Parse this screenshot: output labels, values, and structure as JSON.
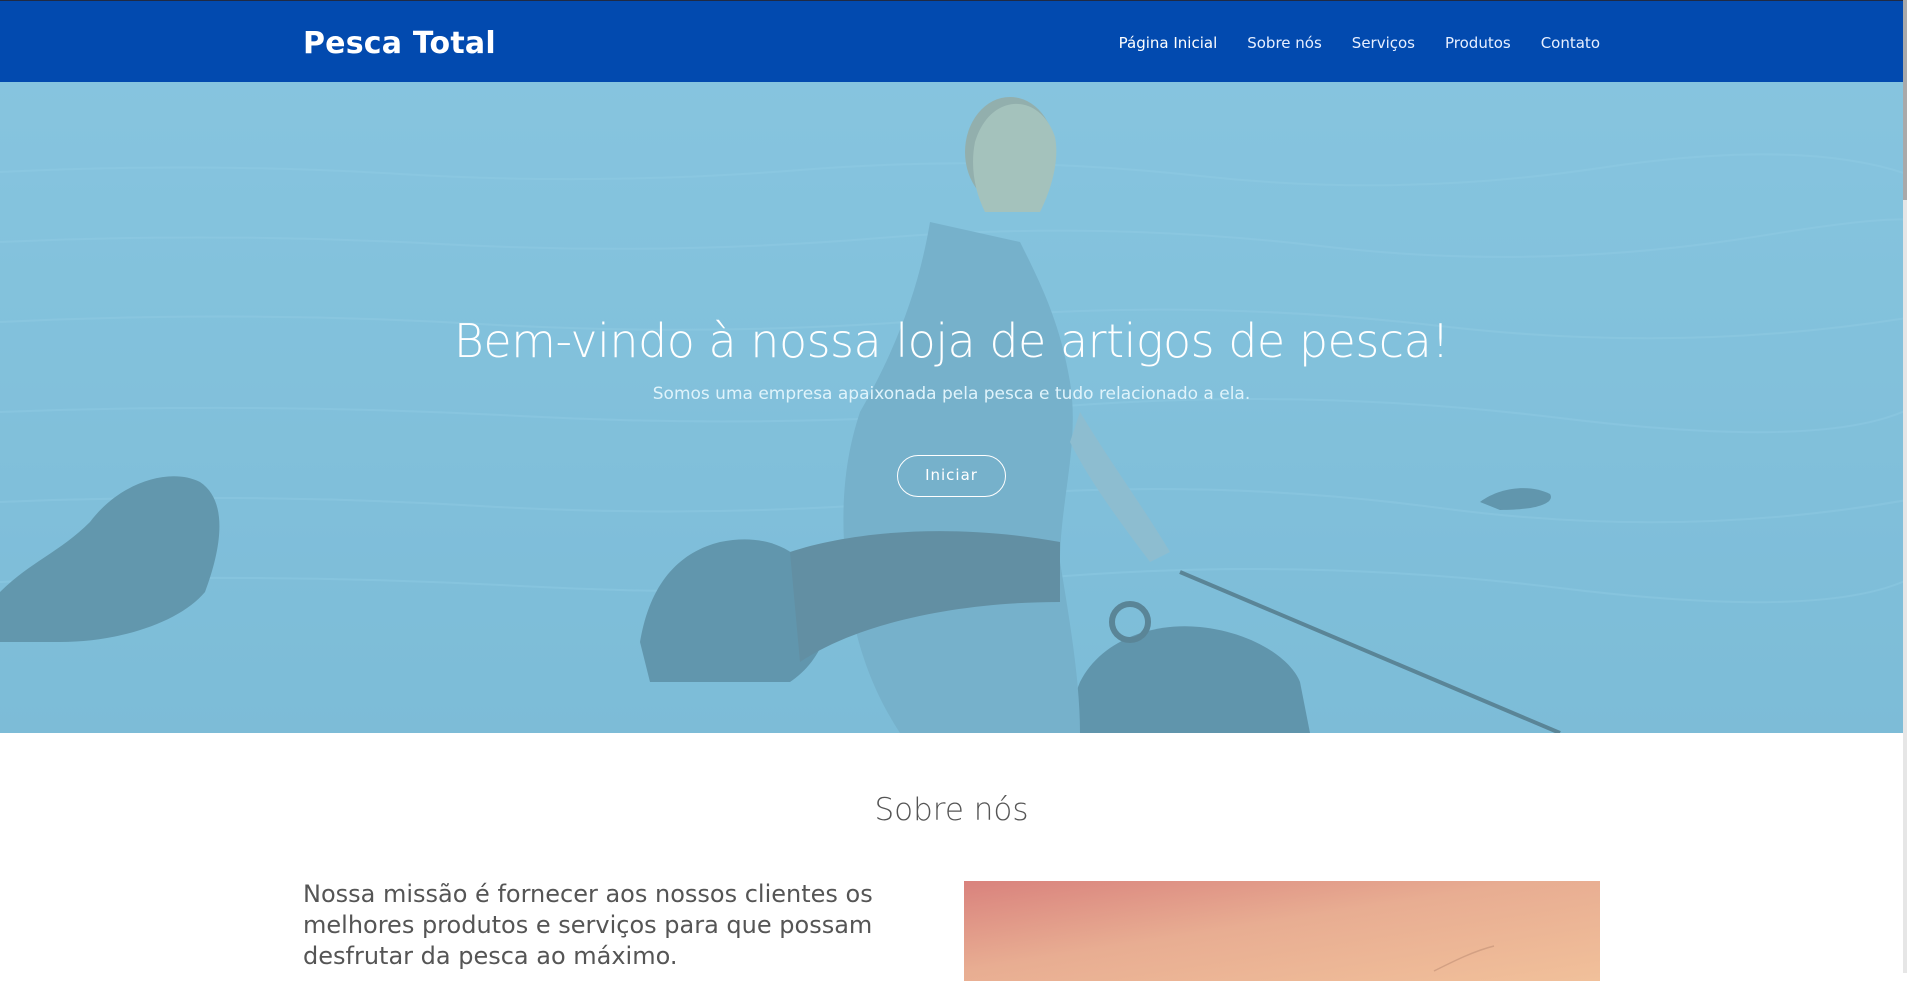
{
  "navbar": {
    "brand": "Pesca Total",
    "links": [
      {
        "label": "Página Inicial",
        "active": true
      },
      {
        "label": "Sobre nós",
        "active": false
      },
      {
        "label": "Serviços",
        "active": false
      },
      {
        "label": "Produtos",
        "active": false
      },
      {
        "label": "Contato",
        "active": false
      }
    ],
    "background": "#024aaf"
  },
  "hero": {
    "title": "Bem-vindo à nossa loja de artigos de pesca!",
    "subtitle": "Somos uma empresa apaixonada pela pesca e tudo relacionado a ela.",
    "button_label": "Iniciar",
    "image": "fisherman-photo"
  },
  "about": {
    "heading": "Sobre nós",
    "text": "Nossa missão é fornecer aos nossos clientes os melhores produtos e serviços para que possam desfrutar da pesca ao máximo.",
    "image": "sunset-photo"
  }
}
